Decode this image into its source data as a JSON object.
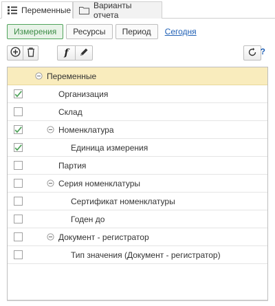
{
  "tabs": [
    {
      "label": "Переменные",
      "icon": "list-settings-icon",
      "active": true
    },
    {
      "label": "Варианты отчета",
      "icon": "folder-icon",
      "active": false
    }
  ],
  "subtabs": {
    "items": [
      {
        "label": "Измерения",
        "active": true
      },
      {
        "label": "Ресурсы",
        "active": false
      },
      {
        "label": "Период",
        "active": false
      }
    ],
    "link": "Сегодня"
  },
  "toolbar": {
    "add_icon": "add-circle-icon",
    "delete_icon": "trash-icon",
    "formula_glyph": "f",
    "edit_icon": "pencil-icon",
    "refresh_icon": "refresh-icon",
    "help_label": "?"
  },
  "colors": {
    "accent_green": "#4fa35a",
    "header_row": "#f9ecbd",
    "link_blue": "#1e5fb5"
  },
  "tree": [
    {
      "label": "Переменные",
      "level": 0,
      "expandable": true,
      "checkbox": false,
      "checked": false
    },
    {
      "label": "Организация",
      "level": 1,
      "expandable": false,
      "checkbox": true,
      "checked": true
    },
    {
      "label": "Склад",
      "level": 1,
      "expandable": false,
      "checkbox": true,
      "checked": false
    },
    {
      "label": "Номенклатура",
      "level": 1,
      "expandable": true,
      "checkbox": true,
      "checked": true
    },
    {
      "label": "Единица измерения",
      "level": 2,
      "expandable": false,
      "checkbox": true,
      "checked": true
    },
    {
      "label": "Партия",
      "level": 1,
      "expandable": false,
      "checkbox": true,
      "checked": false
    },
    {
      "label": "Серия номенклатуры",
      "level": 1,
      "expandable": true,
      "checkbox": true,
      "checked": false
    },
    {
      "label": "Сертификат номенклатуры",
      "level": 2,
      "expandable": false,
      "checkbox": true,
      "checked": false
    },
    {
      "label": "Годен до",
      "level": 2,
      "expandable": false,
      "checkbox": true,
      "checked": false
    },
    {
      "label": "Документ - регистратор",
      "level": 1,
      "expandable": true,
      "checkbox": true,
      "checked": false
    },
    {
      "label": "Тип значения (Документ - регистратор)",
      "level": 2,
      "expandable": false,
      "checkbox": true,
      "checked": false
    }
  ]
}
